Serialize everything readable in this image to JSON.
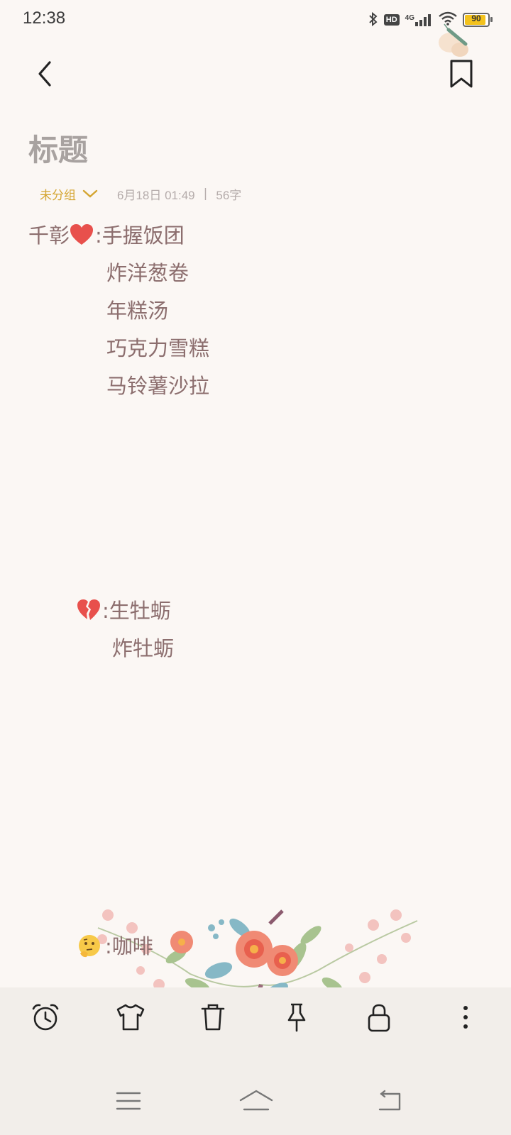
{
  "status_bar": {
    "time": "12:38",
    "hd_label": "HD",
    "network_label": "4G",
    "battery_level": "90",
    "icons": [
      "bluetooth-icon",
      "hd-icon",
      "signal-icon",
      "wifi-icon",
      "battery-icon"
    ]
  },
  "header": {
    "back_icon": "chevron-left-icon",
    "bookmark_icon": "bookmark-icon"
  },
  "note": {
    "title_placeholder": "标题",
    "group": "未分组",
    "date": "6月18日 01:49",
    "separator": "|",
    "word_count": "56字",
    "blocks": [
      {
        "label": "千彰",
        "emoji": "red-heart-emoji",
        "colon": ":",
        "items": [
          "手握饭团",
          "炸洋葱卷",
          "年糕汤",
          "巧克力雪糕",
          "马铃薯沙拉"
        ]
      },
      {
        "label": "",
        "emoji": "broken-heart-emoji",
        "colon": ":",
        "items": [
          "生牡蛎",
          "炸牡蛎"
        ]
      },
      {
        "label": "",
        "emoji": "thinking-face-emoji",
        "colon": ":",
        "items": [
          "咖啡"
        ]
      }
    ]
  },
  "toolbar": {
    "items": [
      "alarm-clock-icon",
      "tshirt-icon",
      "trash-icon",
      "pin-icon",
      "lock-icon",
      "more-vertical-icon"
    ]
  },
  "nav_bar": {
    "items": [
      "menu-icon",
      "home-icon",
      "back-icon"
    ]
  },
  "colors": {
    "background": "#fbf7f4",
    "text": "#8c6e6e",
    "accent": "#d4a531",
    "toolbar_bg": "#f2eeea"
  }
}
